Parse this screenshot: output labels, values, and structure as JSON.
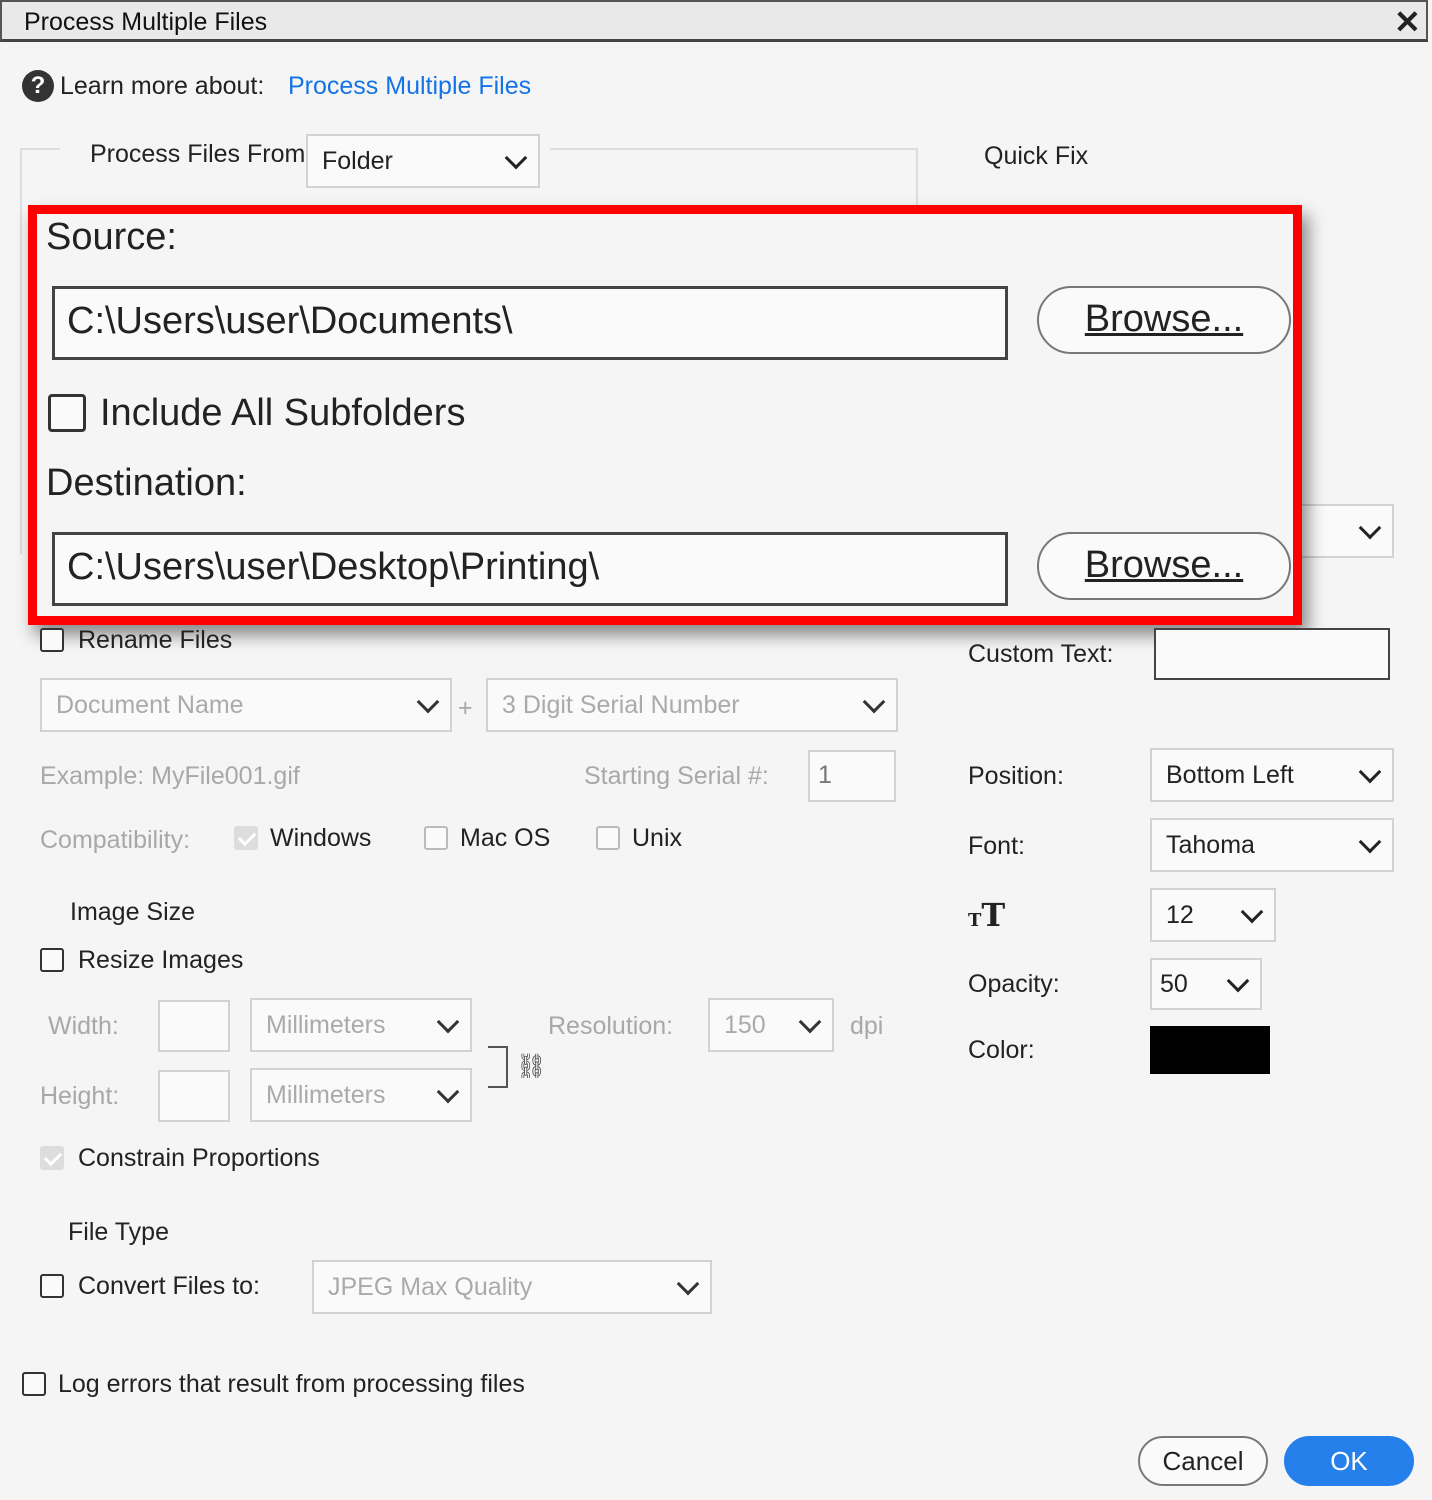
{
  "window": {
    "title": "Process Multiple Files"
  },
  "help": {
    "label": "Learn more about:",
    "link": "Process Multiple Files"
  },
  "process_from": {
    "label": "Process Files From:",
    "value": "Folder"
  },
  "source": {
    "label": "Source:",
    "path": "C:\\Users\\user\\Documents\\",
    "browse": "Browse..."
  },
  "subfolders": {
    "label": "Include All Subfolders",
    "checked": false
  },
  "destination": {
    "label": "Destination:",
    "path": "C:\\Users\\user\\Desktop\\Printing\\",
    "browse": "Browse..."
  },
  "quick_fix": {
    "label": "Quick Fix"
  },
  "rename": {
    "label": "Rename Files",
    "name_option": "Document Name",
    "plus": "+",
    "serial_option": "3 Digit Serial Number",
    "example": "Example: MyFile001.gif",
    "starting_serial_label": "Starting Serial #:",
    "starting_serial_value": "1",
    "compatibility_label": "Compatibility:",
    "windows": "Windows",
    "macos": "Mac OS",
    "unix": "Unix"
  },
  "image_size": {
    "heading": "Image Size",
    "resize_label": "Resize Images",
    "width_label": "Width:",
    "height_label": "Height:",
    "width_unit": "Millimeters",
    "height_unit": "Millimeters",
    "resolution_label": "Resolution:",
    "resolution_value": "150",
    "resolution_unit": "dpi",
    "constrain_label": "Constrain Proportions"
  },
  "file_type": {
    "heading": "File Type",
    "convert_label": "Convert Files to:",
    "convert_value": "JPEG Max Quality"
  },
  "log_errors": {
    "label": "Log errors that result from processing files"
  },
  "watermark": {
    "custom_text_label": "Custom Text:",
    "position_label": "Position:",
    "position_value": "Bottom Left",
    "font_label": "Font:",
    "font_value": "Tahoma",
    "size_value": "12",
    "opacity_label": "Opacity:",
    "opacity_value": "50",
    "color_label": "Color:",
    "color_value": "#000000"
  },
  "buttons": {
    "cancel": "Cancel",
    "ok": "OK"
  },
  "colors": {
    "highlight": "#ff0000",
    "accent": "#2680eb",
    "link": "#1473e6"
  }
}
